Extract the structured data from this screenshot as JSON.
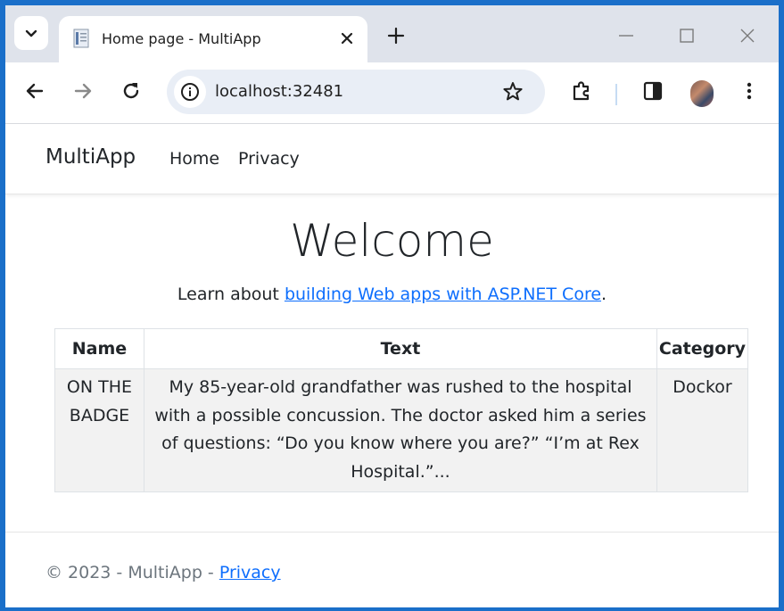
{
  "browser": {
    "tab_title": "Home page - MultiApp",
    "url": "localhost:32481"
  },
  "colors": {
    "link": "#0d6efd",
    "tabstrip": "#dfe3eb",
    "omnibox": "#e9eef6"
  },
  "icons": [
    "tab-search-icon",
    "favicon-icon",
    "close-icon",
    "new-tab-icon",
    "minimize-icon",
    "maximize-icon",
    "window-close-icon",
    "back-icon",
    "forward-icon",
    "reload-icon",
    "info-icon",
    "star-icon",
    "extensions-icon",
    "side-panel-icon",
    "profile-avatar",
    "menu-icon"
  ],
  "navbar": {
    "brand": "MultiApp",
    "links": [
      "Home",
      "Privacy"
    ]
  },
  "main": {
    "heading": "Welcome",
    "learn_prefix": "Learn about ",
    "learn_link": "building Web apps with ASP.NET Core",
    "learn_suffix": "."
  },
  "table": {
    "headers": [
      "Name",
      "Text",
      "Category"
    ],
    "rows": [
      {
        "name": "ON THE BADGE",
        "text": "My 85-year-old grandfather was rushed to the hospital with a possible concussion. The doctor asked him a series of questions: “Do you know where you are?” “I’m at Rex Hospital.”...",
        "category": "Dockor"
      }
    ]
  },
  "footer": {
    "copyright": "© 2023 - MultiApp - ",
    "privacy_link": "Privacy"
  }
}
